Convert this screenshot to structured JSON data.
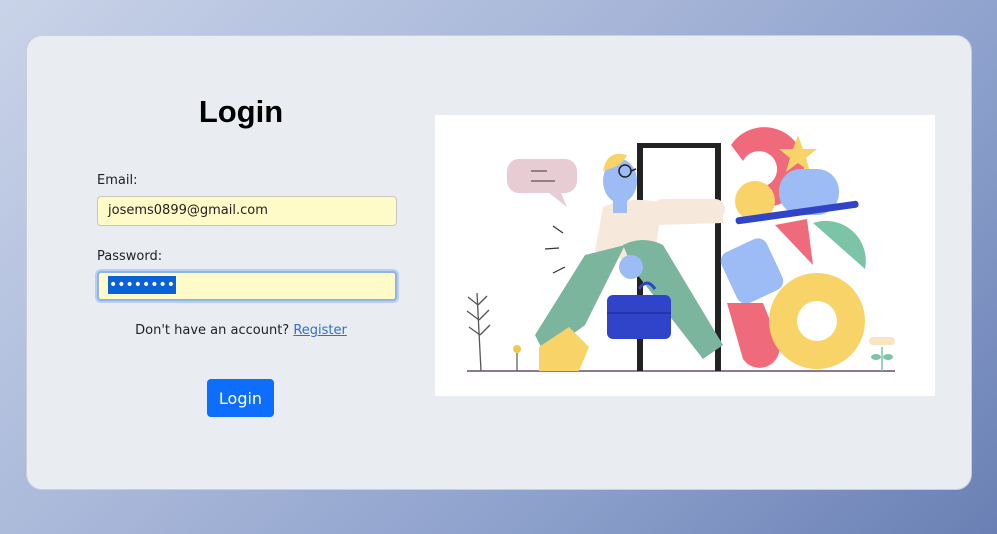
{
  "login": {
    "title": "Login",
    "email_label": "Email:",
    "email_value": "josems0899@gmail.com",
    "password_label": "Password:",
    "password_masked": "••••••••",
    "no_account_text": "Don't have an account?",
    "register_link": "Register",
    "submit_label": "Login"
  },
  "colors": {
    "primary": "#0d6efd",
    "autofill_bg": "#fefbc8",
    "link": "#2f6fd0"
  },
  "icons": {
    "illustration": "person-walking-through-door-illustration"
  }
}
